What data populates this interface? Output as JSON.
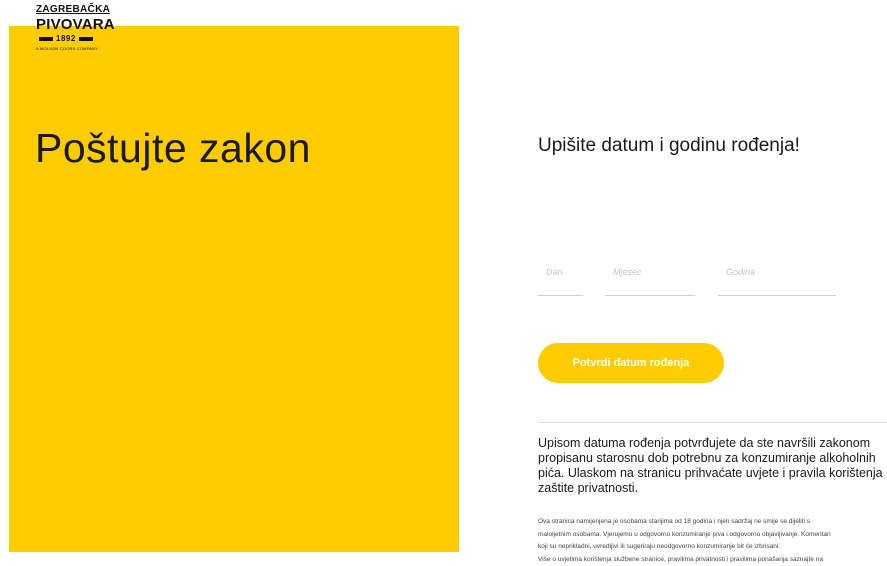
{
  "logo": {
    "line1": "ZAGREBAČKA",
    "line2": "PIVOVARA",
    "year": "1892",
    "tagline": "A MOLSON COORS COMPANY"
  },
  "hero": {
    "title": "Poštujte zakon"
  },
  "form": {
    "heading": "Upišite datum i godinu rođenja!",
    "day_placeholder": "Dan",
    "month_placeholder": "Mjesec",
    "year_placeholder": "Godina",
    "submit_label": "Potvrdi datum rođenja"
  },
  "info": {
    "main_text": "Upisom datuma rođenja potvrđujete da ste navršili zakonom propisanu starosnu dob potrebnu za konzumiranje alkoholnih pića. Ulaskom na stranicu prihvaćate uvjete i pravila korištenja i zaštite privatnosti.",
    "small_line1": "Ova stranica namijenjena je osobama starijima od 18 godina i njen sadržaj ne smije se dijeliti s",
    "small_line2": "maloljetnim osobama. Vjerujemo u odgovorno konzumiranje piva i odgovorno objavljivanje. Komentari",
    "small_line3": "koji su neprikladni, uvredljivi ili sugeriraju neodgovorno konzumiranje bit će izbrisani.",
    "small_line4": "Više o uvjetima korištenja službene stranice, pravilima privatnosti i pravilima ponašanja saznajte na"
  },
  "colors": {
    "brand_yellow": "#ffcc00",
    "text": "#1a1a1a",
    "button_text": "#ffffff"
  }
}
